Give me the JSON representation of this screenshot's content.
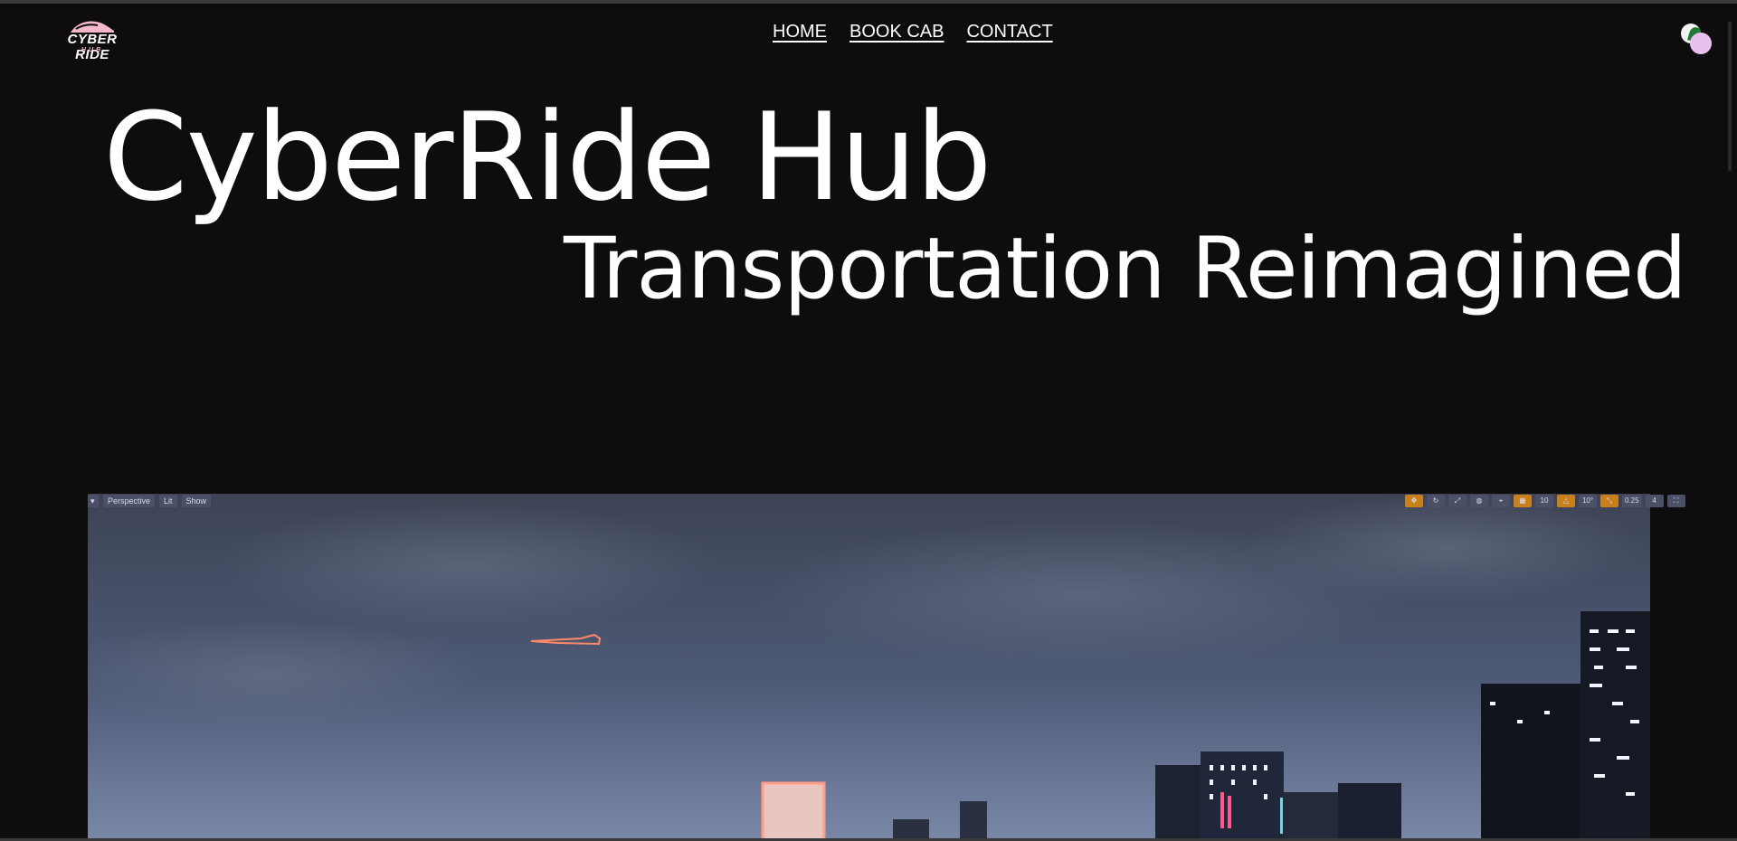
{
  "logo": {
    "main": "CYBER RIDE",
    "sub": "HUB"
  },
  "nav": {
    "items": [
      "HOME",
      "BOOK CAB",
      "CONTACT"
    ]
  },
  "theme_toggle": {
    "icon": "theme-toggle-icon"
  },
  "hero": {
    "title": "CyberRide Hub",
    "subtitle": "Transportation Reimagined"
  },
  "video": {
    "toolbar_left": [
      "Perspective",
      "Lit",
      "Show"
    ],
    "toolbar_right": [
      "10",
      "10°",
      "0.25",
      "4"
    ]
  },
  "colors": {
    "background": "#0e0c0d",
    "text": "#ffffff",
    "accent_pink": "#f3b7c8",
    "toggle_lilac": "#e7c0ee",
    "toggle_green": "#1f7a38"
  }
}
